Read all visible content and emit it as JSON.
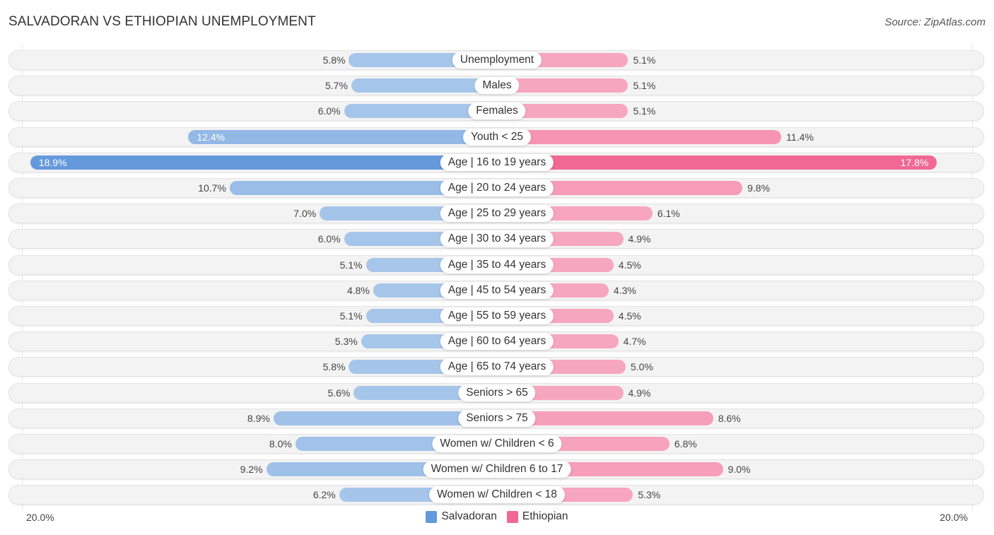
{
  "header": {
    "title": "SALVADORAN VS ETHIOPIAN UNEMPLOYMENT",
    "source": "Source: ZipAtlas.com"
  },
  "chart_data": {
    "type": "bar",
    "orientation": "horizontal-diverging",
    "title": "SALVADORAN VS ETHIOPIAN UNEMPLOYMENT",
    "xlim": [
      -20,
      20
    ],
    "axis_labels": {
      "left": "20.0%",
      "right": "20.0%"
    },
    "legend": {
      "position": "bottom-center",
      "entries": [
        "Salvadoran",
        "Ethiopian"
      ]
    },
    "colors": {
      "Salvadoran": "#a7c6ea",
      "Salvadoran_strong": "#6499dc",
      "Ethiopian": "#f7a6c0",
      "Ethiopian_strong": "#f06893"
    },
    "categories": [
      "Unemployment",
      "Males",
      "Females",
      "Youth < 25",
      "Age | 16 to 19 years",
      "Age | 20 to 24 years",
      "Age | 25 to 29 years",
      "Age | 30 to 34 years",
      "Age | 35 to 44 years",
      "Age | 45 to 54 years",
      "Age | 55 to 59 years",
      "Age | 60 to 64 years",
      "Age | 65 to 74 years",
      "Seniors > 65",
      "Seniors > 75",
      "Women w/ Children < 6",
      "Women w/ Children 6 to 17",
      "Women w/ Children < 18"
    ],
    "series": [
      {
        "name": "Salvadoran",
        "values": [
          5.8,
          5.7,
          6.0,
          12.4,
          18.9,
          10.7,
          7.0,
          6.0,
          5.1,
          4.8,
          5.1,
          5.3,
          5.8,
          5.6,
          8.9,
          8.0,
          9.2,
          6.2
        ]
      },
      {
        "name": "Ethiopian",
        "values": [
          5.1,
          5.1,
          5.1,
          11.4,
          17.8,
          9.8,
          6.1,
          4.9,
          4.5,
          4.3,
          4.5,
          4.7,
          5.0,
          4.9,
          8.6,
          6.8,
          9.0,
          5.3
        ]
      }
    ]
  }
}
